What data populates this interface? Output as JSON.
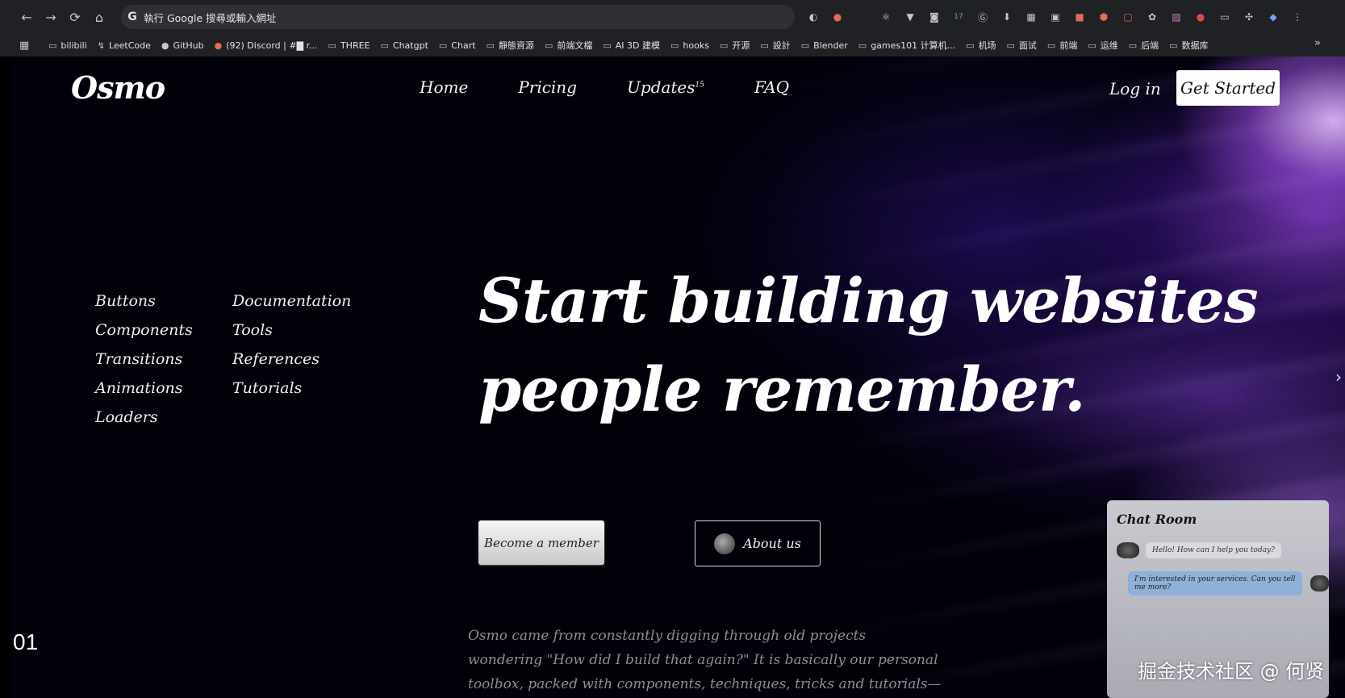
{
  "browser": {
    "address_text": "執行 Google 搜尋或輸入網址",
    "bookmarks": [
      {
        "label": "bilibili",
        "icon": "bilibili-icon"
      },
      {
        "label": "LeetCode",
        "icon": "leetcode-icon"
      },
      {
        "label": "GitHub",
        "icon": "github-icon"
      },
      {
        "label": "(92) Discord | #▇ r...",
        "icon": "discord-icon"
      },
      {
        "label": "THREE",
        "icon": "folder-icon"
      },
      {
        "label": "Chatgpt",
        "icon": "folder-icon"
      },
      {
        "label": "Chart",
        "icon": "folder-icon"
      },
      {
        "label": "靜態資源",
        "icon": "folder-icon"
      },
      {
        "label": "前端文檔",
        "icon": "folder-icon"
      },
      {
        "label": "AI 3D 建模",
        "icon": "folder-icon"
      },
      {
        "label": "hooks",
        "icon": "folder-icon"
      },
      {
        "label": "开源",
        "icon": "folder-icon"
      },
      {
        "label": "設計",
        "icon": "folder-icon"
      },
      {
        "label": "Blender",
        "icon": "folder-icon"
      },
      {
        "label": "games101 计算机...",
        "icon": "folder-icon"
      },
      {
        "label": "机场",
        "icon": "folder-icon"
      },
      {
        "label": "面试",
        "icon": "folder-icon"
      },
      {
        "label": "前端",
        "icon": "folder-icon"
      },
      {
        "label": "运维",
        "icon": "folder-icon"
      },
      {
        "label": "后端",
        "icon": "folder-icon"
      },
      {
        "label": "数据库",
        "icon": "folder-icon"
      }
    ],
    "ext_badge": "17"
  },
  "site": {
    "logo": "Osmo",
    "nav": [
      "Home",
      "Pricing",
      "Updates",
      "FAQ"
    ],
    "nav_sup": "15",
    "login": "Log in",
    "cta": "Get Started",
    "links_col1": [
      "Buttons",
      "Components",
      "Transitions",
      "Animations",
      "Loaders"
    ],
    "links_col2": [
      "Documentation",
      "Tools",
      "References",
      "Tutorials"
    ],
    "hero": "Start building websites people remember.",
    "btn_member": "Become a member",
    "btn_about": "About us",
    "description": "Osmo came from constantly digging through old projects wondering \"How did I build that again?\" It is basically our personal toolbox, packed with components, techniques, tricks and tutorials—and it will keep growing.",
    "chat": {
      "title": "Chat Room",
      "msg1": "Hello! How can I help you today?",
      "msg2": "I'm interested in your services. Can you tell me more?"
    }
  },
  "overlay": {
    "slide_number": "01",
    "watermark": "掘金技术社区 @ 何贤"
  },
  "colors": {
    "accent_purple": "#9b5de5",
    "page_bg": "#010109",
    "browser_bg": "#202124"
  }
}
